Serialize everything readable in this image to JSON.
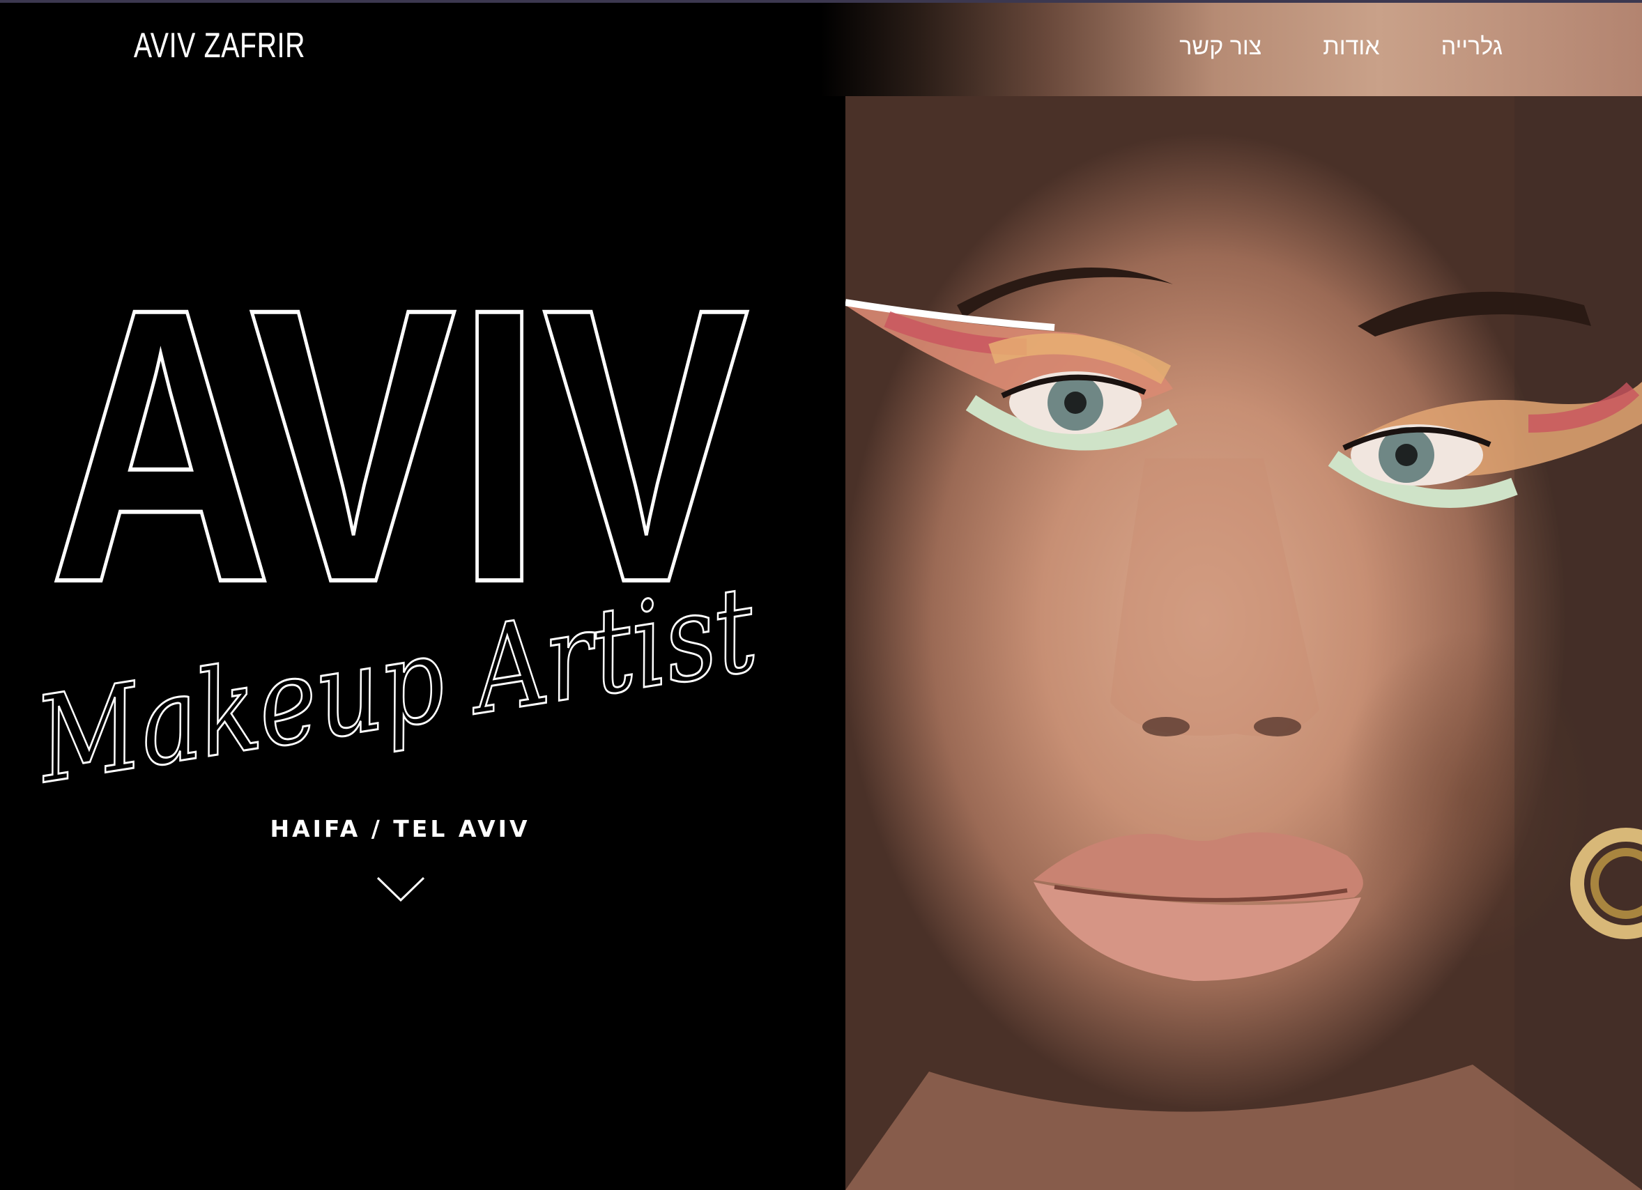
{
  "header": {
    "logo": "AVIV ZAFRIR",
    "nav": [
      {
        "label": "גלרייה"
      },
      {
        "label": "אודות"
      },
      {
        "label": "צור קשר"
      }
    ]
  },
  "hero": {
    "title": "AVIV",
    "subtitle": "Makeup Artist",
    "location": "HAIFA / TEL AVIV",
    "scroll_icon": "chevron-down-icon"
  },
  "photo": {
    "subject": "portrait-photo"
  },
  "colors": {
    "background": "#000000",
    "text": "#ffffff"
  }
}
